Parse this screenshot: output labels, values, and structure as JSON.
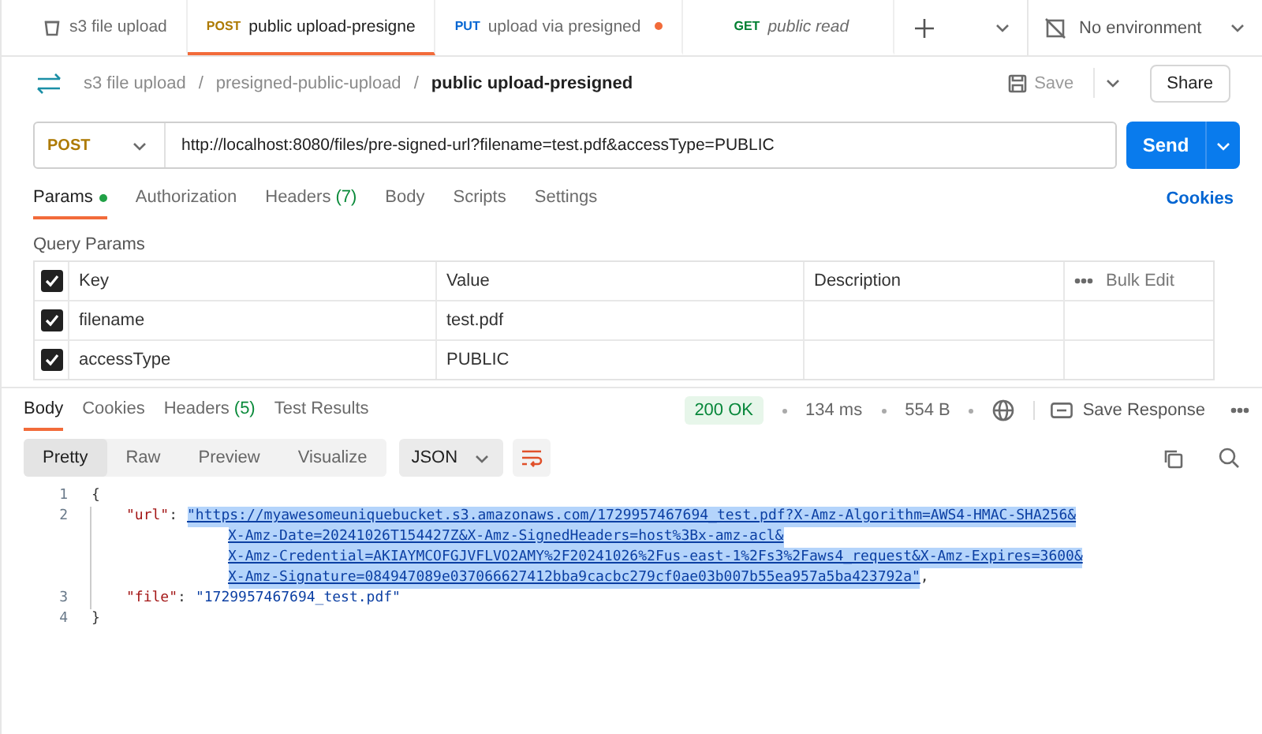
{
  "tabs": [
    {
      "kind": "collection",
      "label": "s3 file upload",
      "selected": false,
      "unsaved": false,
      "italic": false
    },
    {
      "kind": "request",
      "method": "POST",
      "label": "public upload-presigne",
      "selected": true,
      "unsaved": false,
      "italic": false
    },
    {
      "kind": "request",
      "method": "PUT",
      "label": "upload via presigned",
      "selected": false,
      "unsaved": true,
      "italic": false
    },
    {
      "kind": "request",
      "method": "GET",
      "label": "public read",
      "selected": false,
      "unsaved": false,
      "italic": true
    }
  ],
  "environment": "No environment",
  "breadcrumb": [
    "s3 file upload",
    "presigned-public-upload",
    "public upload-presigned"
  ],
  "breadcrumb_separators": [
    "/",
    "/"
  ],
  "save": "Save",
  "share": "Share",
  "request": {
    "method": "POST",
    "url": "http://localhost:8080/files/pre-signed-url?filename=test.pdf&accessType=PUBLIC",
    "send": "Send"
  },
  "request_tabs": [
    {
      "label": "Params",
      "dot": true,
      "selected": true
    },
    {
      "label": "Authorization",
      "dot": false,
      "selected": false
    },
    {
      "label": "Headers",
      "count": "(7)",
      "dot": false,
      "selected": false
    },
    {
      "label": "Body",
      "dot": false,
      "selected": false
    },
    {
      "label": "Scripts",
      "dot": false,
      "selected": false
    },
    {
      "label": "Settings",
      "dot": false,
      "selected": false
    }
  ],
  "cookies": "Cookies",
  "query_params": {
    "title": "Query Params",
    "all_checked": true,
    "columns": [
      "Key",
      "Value",
      "Description"
    ],
    "bulk_edit": "Bulk Edit",
    "rows": [
      {
        "checked": true,
        "key": "filename",
        "value": "test.pdf"
      },
      {
        "checked": true,
        "key": "accessType",
        "value": "PUBLIC"
      }
    ]
  },
  "response_tabs": [
    {
      "label": "Body",
      "selected": true
    },
    {
      "label": "Cookies",
      "selected": false
    },
    {
      "label": "Headers",
      "count": "(5)",
      "selected": false
    },
    {
      "label": "Test Results",
      "selected": false
    }
  ],
  "status": "200 OK",
  "time": "134 ms",
  "size": "554 B",
  "save_response": "Save Response",
  "view_modes": [
    {
      "label": "Pretty",
      "selected": true
    },
    {
      "label": "Raw",
      "selected": false
    },
    {
      "label": "Preview",
      "selected": false
    },
    {
      "label": "Visualize",
      "selected": false
    }
  ],
  "format": "JSON",
  "code": [
    {
      "number": "1",
      "kind": "punct",
      "text": "{"
    },
    {
      "number": "2",
      "kind": "pair",
      "key": "\"url\"",
      "colon": ":",
      "selected": true,
      "value_lines": [
        "\"https://myawesomeuniquebucket.s3.amazonaws.com/1729957467694_test.pdf?X-Amz-Algorithm=AWS4-HMAC-SHA256&",
        "X-Amz-Date=20241026T154427Z&X-Amz-SignedHeaders=host%3Bx-amz-acl&",
        "X-Amz-Credential=AKIAYMCOFGJVFLVO2AMY%2F20241026%2Fus-east-1%2Fs3%2Faws4_request&X-Amz-Expires=3600&",
        "X-Amz-Signature=084947089e037066627412bba9cacbc279cf0ae03b007b55ea957a5ba423792a\""
      ],
      "trailing": ","
    },
    {
      "number": "3",
      "kind": "pair",
      "key": "\"file\"",
      "colon": ":",
      "selected": false,
      "value_lines": [
        "\"1729957467694_test.pdf\""
      ]
    },
    {
      "number": "4",
      "kind": "punct",
      "text": "}"
    }
  ]
}
